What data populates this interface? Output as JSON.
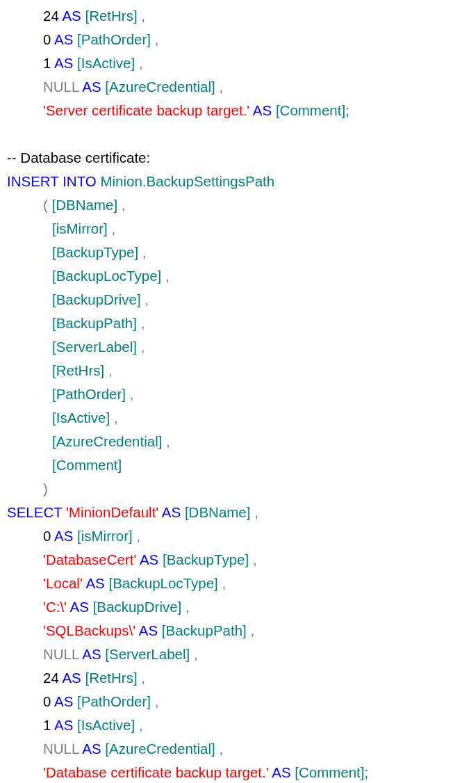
{
  "code": [
    {
      "children": [
        {
          "tokens": [
            {
              "kind": "number",
              "text": "24"
            },
            {
              "kind": "keyword",
              "text": "AS"
            },
            {
              "kind": "ident",
              "text": "[RetHrs]"
            },
            {
              "kind": "punct",
              "text": ","
            }
          ]
        },
        {
          "tokens": [
            {
              "kind": "number",
              "text": "0"
            },
            {
              "kind": "keyword",
              "text": "AS"
            },
            {
              "kind": "ident",
              "text": "[PathOrder]"
            },
            {
              "kind": "punct",
              "text": ","
            }
          ]
        },
        {
          "tokens": [
            {
              "kind": "number",
              "text": "1"
            },
            {
              "kind": "keyword",
              "text": "AS"
            },
            {
              "kind": "ident",
              "text": "[IsActive]"
            },
            {
              "kind": "punct",
              "text": ","
            }
          ]
        },
        {
          "tokens": [
            {
              "kind": "null",
              "text": "NULL"
            },
            {
              "kind": "keyword",
              "text": "AS"
            },
            {
              "kind": "ident",
              "text": "[AzureCredential]"
            },
            {
              "kind": "punct",
              "text": ","
            }
          ]
        },
        {
          "tokens": [
            {
              "kind": "string",
              "text": "'Server certificate backup target.'"
            },
            {
              "kind": "keyword",
              "text": "AS"
            },
            {
              "kind": "ident",
              "text": "[Comment];"
            }
          ]
        }
      ]
    },
    {
      "tokens": [
        {
          "kind": "comment",
          "text": "-- Database certificate:"
        }
      ]
    },
    {
      "tokens": [
        {
          "kind": "keyword",
          "text": "INSERT"
        },
        {
          "kind": "keyword",
          "text": "INTO"
        },
        {
          "kind": "ident",
          "text": "Minion.BackupSettingsPath"
        }
      ],
      "children": [
        {
          "tokens": [
            {
              "kind": "punct",
              "text": "("
            },
            {
              "kind": "ident",
              "text": "[DBName]"
            },
            {
              "kind": "punct",
              "text": ","
            }
          ],
          "children": [
            {
              "tokens": [
                {
                  "kind": "ident",
                  "text": "[isMirror]"
                },
                {
                  "kind": "punct",
                  "text": ","
                }
              ]
            },
            {
              "tokens": [
                {
                  "kind": "ident",
                  "text": "[BackupType]"
                },
                {
                  "kind": "punct",
                  "text": ","
                }
              ]
            },
            {
              "tokens": [
                {
                  "kind": "ident",
                  "text": "[BackupLocType]"
                },
                {
                  "kind": "punct",
                  "text": ","
                }
              ]
            },
            {
              "tokens": [
                {
                  "kind": "ident",
                  "text": "[BackupDrive]"
                },
                {
                  "kind": "punct",
                  "text": ","
                }
              ]
            },
            {
              "tokens": [
                {
                  "kind": "ident",
                  "text": "[BackupPath]"
                },
                {
                  "kind": "punct",
                  "text": ","
                }
              ]
            },
            {
              "tokens": [
                {
                  "kind": "ident",
                  "text": "[ServerLabel]"
                },
                {
                  "kind": "punct",
                  "text": ","
                }
              ]
            },
            {
              "tokens": [
                {
                  "kind": "ident",
                  "text": "[RetHrs]"
                },
                {
                  "kind": "punct",
                  "text": ","
                }
              ]
            },
            {
              "tokens": [
                {
                  "kind": "ident",
                  "text": "[PathOrder]"
                },
                {
                  "kind": "punct",
                  "text": ","
                }
              ]
            },
            {
              "tokens": [
                {
                  "kind": "ident",
                  "text": "[IsActive]"
                },
                {
                  "kind": "punct",
                  "text": ","
                }
              ]
            },
            {
              "tokens": [
                {
                  "kind": "ident",
                  "text": "[AzureCredential]"
                },
                {
                  "kind": "punct",
                  "text": ","
                }
              ]
            },
            {
              "tokens": [
                {
                  "kind": "ident",
                  "text": "[Comment]"
                }
              ]
            }
          ]
        },
        {
          "tokens": [
            {
              "kind": "punct",
              "text": ")"
            }
          ]
        }
      ]
    },
    {
      "tokens": [
        {
          "kind": "keyword",
          "text": "SELECT"
        },
        {
          "kind": "string",
          "text": "'MinionDefault'"
        },
        {
          "kind": "keyword",
          "text": "AS"
        },
        {
          "kind": "ident",
          "text": "[DBName]"
        },
        {
          "kind": "punct",
          "text": ","
        }
      ],
      "children": [
        {
          "tokens": [
            {
              "kind": "number",
              "text": "0"
            },
            {
              "kind": "keyword",
              "text": "AS"
            },
            {
              "kind": "ident",
              "text": "[isMirror]"
            },
            {
              "kind": "punct",
              "text": ","
            }
          ]
        },
        {
          "tokens": [
            {
              "kind": "string",
              "text": "'DatabaseCert'"
            },
            {
              "kind": "keyword",
              "text": "AS"
            },
            {
              "kind": "ident",
              "text": "[BackupType]"
            },
            {
              "kind": "punct",
              "text": ","
            }
          ]
        },
        {
          "tokens": [
            {
              "kind": "string",
              "text": "'Local'"
            },
            {
              "kind": "keyword",
              "text": "AS"
            },
            {
              "kind": "ident",
              "text": "[BackupLocType]"
            },
            {
              "kind": "punct",
              "text": ","
            }
          ]
        },
        {
          "tokens": [
            {
              "kind": "string",
              "text": "'C:\\'"
            },
            {
              "kind": "keyword",
              "text": "AS"
            },
            {
              "kind": "ident",
              "text": "[BackupDrive]"
            },
            {
              "kind": "punct",
              "text": ","
            }
          ]
        },
        {
          "tokens": [
            {
              "kind": "string",
              "text": "'SQLBackups\\'"
            },
            {
              "kind": "keyword",
              "text": "AS"
            },
            {
              "kind": "ident",
              "text": "[BackupPath]"
            },
            {
              "kind": "punct",
              "text": ","
            }
          ]
        },
        {
          "tokens": [
            {
              "kind": "null",
              "text": "NULL"
            },
            {
              "kind": "keyword",
              "text": "AS"
            },
            {
              "kind": "ident",
              "text": "[ServerLabel]"
            },
            {
              "kind": "punct",
              "text": ","
            }
          ]
        },
        {
          "tokens": [
            {
              "kind": "number",
              "text": "24"
            },
            {
              "kind": "keyword",
              "text": "AS"
            },
            {
              "kind": "ident",
              "text": "[RetHrs]"
            },
            {
              "kind": "punct",
              "text": ","
            }
          ]
        },
        {
          "tokens": [
            {
              "kind": "number",
              "text": "0"
            },
            {
              "kind": "keyword",
              "text": "AS"
            },
            {
              "kind": "ident",
              "text": "[PathOrder]"
            },
            {
              "kind": "punct",
              "text": ","
            }
          ]
        },
        {
          "tokens": [
            {
              "kind": "number",
              "text": "1"
            },
            {
              "kind": "keyword",
              "text": "AS"
            },
            {
              "kind": "ident",
              "text": "[IsActive]"
            },
            {
              "kind": "punct",
              "text": ","
            }
          ]
        },
        {
          "tokens": [
            {
              "kind": "null",
              "text": "NULL"
            },
            {
              "kind": "keyword",
              "text": "AS"
            },
            {
              "kind": "ident",
              "text": "[AzureCredential]"
            },
            {
              "kind": "punct",
              "text": ","
            }
          ]
        },
        {
          "tokens": [
            {
              "kind": "string",
              "text": "'Database certificate backup target.'"
            },
            {
              "kind": "keyword",
              "text": "AS"
            },
            {
              "kind": "ident",
              "text": "[Comment];"
            }
          ]
        }
      ]
    }
  ]
}
